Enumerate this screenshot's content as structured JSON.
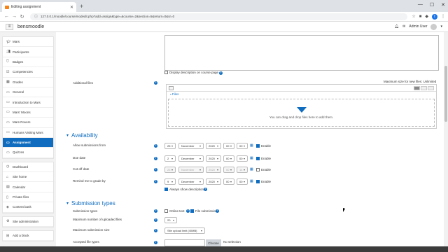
{
  "browser": {
    "tab_title": "Editing assignment",
    "url": "127.0.0.1/moodle/course/modedit.php?add=assign&type=&course=2&section=5&return=0&sr=0"
  },
  "navbar": {
    "brand": "bensmoodle",
    "user": "Admin User"
  },
  "sidebar": {
    "course_items": [
      {
        "label": "Mars",
        "icon": "graduation-cap-icon",
        "active": false
      },
      {
        "label": "Participants",
        "icon": "users-icon",
        "active": false
      },
      {
        "label": "Badges",
        "icon": "shield-icon",
        "active": false
      },
      {
        "label": "Competencies",
        "icon": "check-square-icon",
        "active": false
      },
      {
        "label": "Grades",
        "icon": "table-icon",
        "active": false
      },
      {
        "label": "General",
        "icon": "folder-icon",
        "active": false
      },
      {
        "label": "Introduction to Mars",
        "icon": "folder-icon",
        "active": false
      },
      {
        "label": "Mars' Moons",
        "icon": "folder-icon",
        "active": false
      },
      {
        "label": "Mars Rovers",
        "icon": "folder-icon",
        "active": false
      },
      {
        "label": "Humans Visiting Mars",
        "icon": "folder-icon",
        "active": false
      },
      {
        "label": "Assignment",
        "icon": "folder-icon",
        "active": true
      },
      {
        "label": "Quizzes",
        "icon": "folder-icon",
        "active": false
      }
    ],
    "site_items": [
      {
        "label": "Dashboard",
        "icon": "dashboard-icon"
      },
      {
        "label": "Site home",
        "icon": "home-icon"
      },
      {
        "label": "Calendar",
        "icon": "calendar-icon"
      },
      {
        "label": "Private files",
        "icon": "file-icon"
      },
      {
        "label": "Content bank",
        "icon": "cube-icon"
      }
    ],
    "admin_items": [
      {
        "label": "Site administration",
        "icon": "wrench-icon"
      }
    ],
    "block_items": [
      {
        "label": "Add a block",
        "icon": "plus-square-icon"
      }
    ]
  },
  "form": {
    "display_description": "Display description on course page",
    "additional_files": {
      "label": "Additional files",
      "max_size": "Maximum size for new files: Unlimited",
      "path": "Files",
      "drop_text": "You can drag and drop files here to add them."
    },
    "availability": {
      "title": "Availability",
      "rows": [
        {
          "label": "Allow submissions from",
          "day": "25",
          "month": "November",
          "year": "2020",
          "hour": "00",
          "minute": "00",
          "enable": "Enable",
          "enabled": true
        },
        {
          "label": "Due date",
          "day": "2",
          "month": "December",
          "year": "2020",
          "hour": "00",
          "minute": "00",
          "enable": "Enable",
          "enabled": true
        },
        {
          "label": "Cut-off date",
          "day": "25",
          "month": "November",
          "year": "2020",
          "hour": "00",
          "minute": "14",
          "enable": "Enable",
          "enabled": false
        },
        {
          "label": "Remind me to grade by",
          "day": "9",
          "month": "December",
          "year": "2020",
          "hour": "00",
          "minute": "00",
          "enable": "Enable",
          "enabled": true
        }
      ],
      "always_show": "Always show description"
    },
    "submission_types": {
      "title": "Submission types",
      "types_label": "Submission types",
      "online_text": "Online text",
      "file_submissions": "File submissions",
      "max_files_label": "Maximum number of uploaded files",
      "max_files_value": "20",
      "max_size_label": "Maximum submission size",
      "max_size_value": "Site upload limit (40MB)",
      "accepted_label": "Accepted file types",
      "choose_button": "Choose",
      "no_selection": "No selection"
    }
  },
  "colors": {
    "accent": "#0f6cbf",
    "sidebar_bg": "#f2f2f2"
  }
}
